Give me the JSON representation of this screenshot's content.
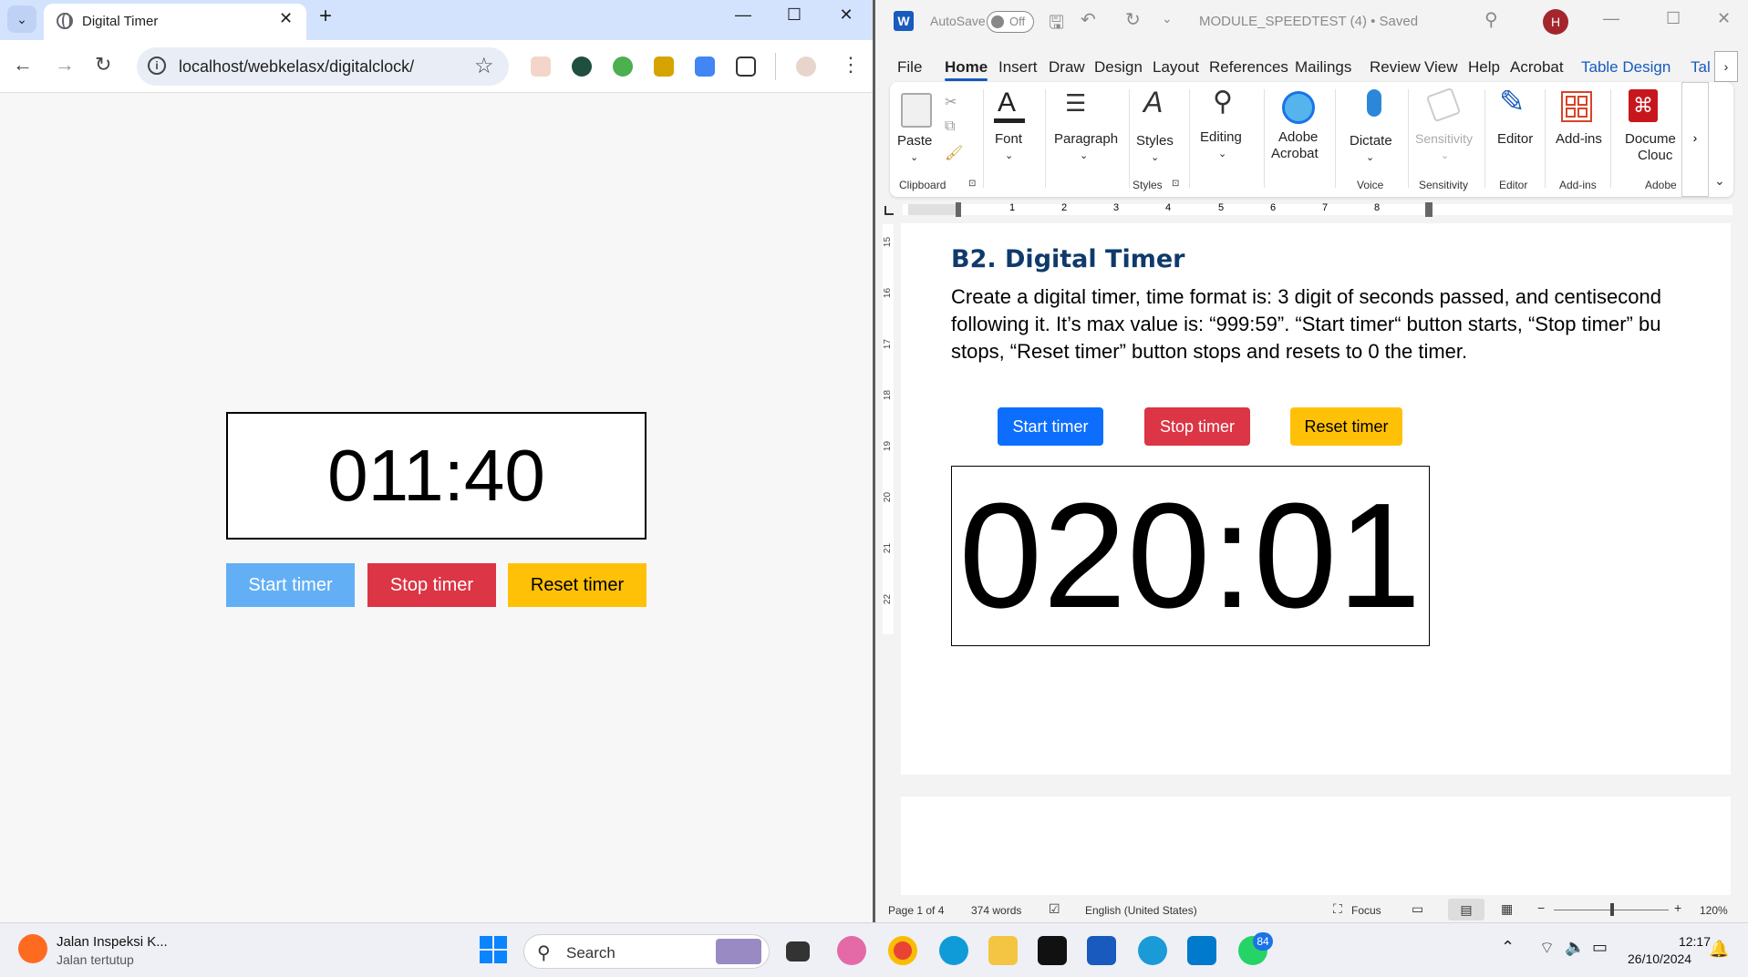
{
  "chrome": {
    "tab_title": "Digital Timer",
    "url": "localhost/webkelasx/digitalclock/",
    "timer_value": "011:40",
    "buttons": {
      "start": "Start timer",
      "stop": "Stop timer",
      "reset": "Reset timer"
    },
    "colors": {
      "start": "#63aff6",
      "stop": "#dc3545",
      "reset": "#ffc107"
    }
  },
  "word": {
    "autosave_label": "AutoSave",
    "autosave_state": "Off",
    "doc_title": "MODULE_SPEEDTEST (4) • Saved",
    "avatar_letter": "H",
    "menu": [
      "File",
      "Home",
      "Insert",
      "Draw",
      "Design",
      "Layout",
      "References",
      "Mailings",
      "Review",
      "View",
      "Help",
      "Acrobat",
      "Table Design",
      "Tal"
    ],
    "ribbon": {
      "paste": "Paste",
      "font": "Font",
      "paragraph": "Paragraph",
      "styles": "Styles",
      "editing": "Editing",
      "adobe_acrobat_1": "Adobe",
      "adobe_acrobat_2": "Acrobat",
      "dictate": "Dictate",
      "sensitivity": "Sensitivity",
      "editor": "Editor",
      "addins": "Add-ins",
      "document_cloud_1": "Docume",
      "document_cloud_2": "Clouc",
      "groups": {
        "clipboard": "Clipboard",
        "styles": "Styles",
        "voice": "Voice",
        "sensitivity": "Sensitivity",
        "editor": "Editor",
        "addins": "Add-ins",
        "adobe": "Adobe"
      }
    },
    "ruler_numbers": [
      "1",
      "2",
      "3",
      "4",
      "5",
      "6",
      "7",
      "8"
    ],
    "vruler_numbers": [
      "15",
      "16",
      "17",
      "18",
      "19",
      "20",
      "21",
      "22"
    ],
    "heading": "B2. Digital Timer",
    "body_line1": "Create a digital timer, time format is: 3 digit of seconds passed, and centisecond",
    "body_line2": "following it. It’s max value is: “999:59”. “Start timer“ button starts, “Stop timer” bu",
    "body_line3": "stops, “Reset timer” button stops and resets to 0 the timer.",
    "buttons": {
      "start": "Start timer",
      "stop": "Stop timer",
      "reset": "Reset timer"
    },
    "colors": {
      "start": "#0d6efd",
      "stop": "#dc3545",
      "reset": "#ffc107",
      "heading": "#0f3a6b"
    },
    "timer_value": "020:01",
    "status": {
      "page": "Page 1 of 4",
      "words": "374 words",
      "language": "English (United States)",
      "focus": "Focus",
      "zoom": "120%"
    }
  },
  "taskbar": {
    "notification_title": "Jalan Inspeksi K...",
    "notification_subtitle": "Jalan tertutup",
    "search_label": "Search",
    "whatsapp_badge": "84",
    "time": "12:17",
    "date": "26/10/2024"
  }
}
